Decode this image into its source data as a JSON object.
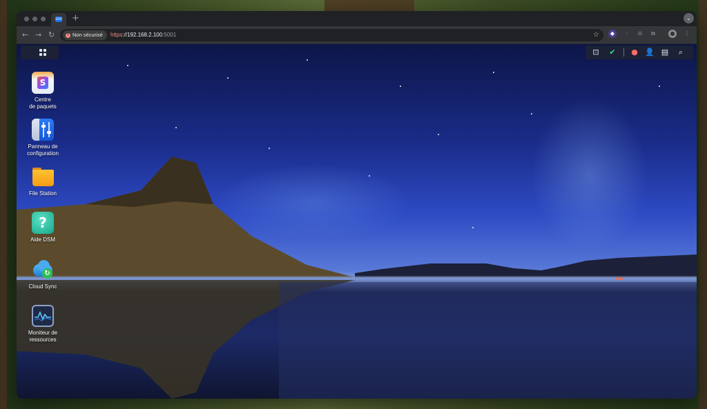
{
  "browser": {
    "tab_favicon": "DSM",
    "new_tab_glyph": "+",
    "tab_menu_glyph": "⌄",
    "security_chip": "Non sécurisé",
    "url": {
      "scheme": "https",
      "separator": "://",
      "host": "192.168.2.100",
      "port": ":5001"
    }
  },
  "dsm": {
    "desktop_icons": [
      {
        "label_line1": "Centre",
        "label_line2": "de paquets",
        "icon": "package-center-icon"
      },
      {
        "label_line1": "Panneau de",
        "label_line2": "configuration",
        "icon": "control-panel-icon"
      },
      {
        "label_line1": "File Station",
        "label_line2": "",
        "icon": "file-station-icon"
      },
      {
        "label_line1": "Aide DSM",
        "label_line2": "",
        "icon": "dsm-help-icon"
      },
      {
        "label_line1": "Cloud Sync",
        "label_line2": "",
        "icon": "cloud-sync-icon"
      },
      {
        "label_line1": "Moniteur de",
        "label_line2": "ressources",
        "icon": "resource-monitor-icon"
      }
    ],
    "taskbar_right_icons": [
      "notifications-icon",
      "backup-status-icon",
      "chat-icon",
      "user-icon",
      "widgets-icon",
      "search-icon"
    ],
    "help_glyph": "?",
    "package_glyph": "S",
    "sync_glyph": "↻"
  },
  "colors": {
    "insecure_red": "#f28b82",
    "chrome_bg": "#35363a",
    "dsm_taskbar": "#1e2332"
  }
}
